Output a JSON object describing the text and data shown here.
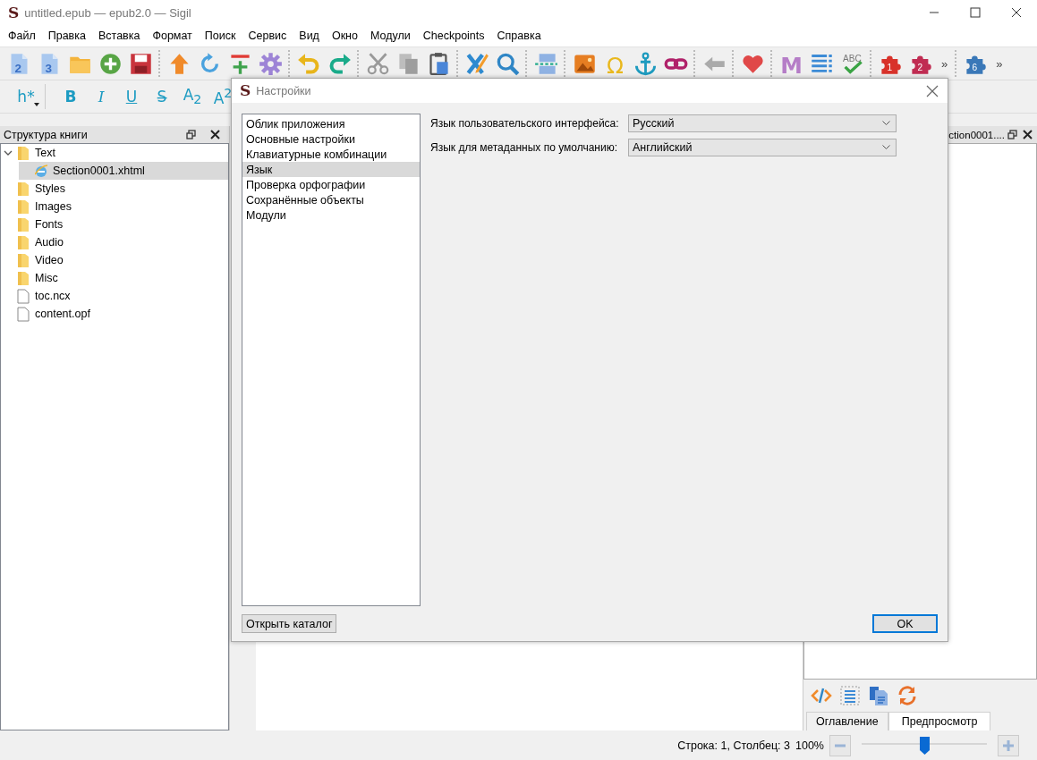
{
  "window": {
    "logo": "S",
    "title": "untitled.epub — epub2.0 — Sigil"
  },
  "menu": [
    "Файл",
    "Правка",
    "Вставка",
    "Формат",
    "Поиск",
    "Сервис",
    "Вид",
    "Окно",
    "Модули",
    "Checkpoints",
    "Справка"
  ],
  "main_toolbar": {
    "icon_texts": [
      "2",
      "3",
      "Ω",
      "M",
      "ABC",
      "1",
      "2",
      "6"
    ],
    "overflow": [
      "»",
      "»"
    ]
  },
  "format_toolbar": [
    "h*",
    "B",
    "I",
    "U",
    "S̶",
    "A$_{2}$",
    "A$^{2}$"
  ],
  "book_browser": {
    "title": "Структура книги",
    "tree": [
      {
        "label": "Text",
        "kind": "folder",
        "expanded": true,
        "selected": false,
        "children": [
          {
            "label": "Section0001.xhtml",
            "kind": "page",
            "selected": true
          }
        ]
      },
      {
        "label": "Styles",
        "kind": "folder",
        "selected": false
      },
      {
        "label": "Images",
        "kind": "folder",
        "selected": false
      },
      {
        "label": "Fonts",
        "kind": "folder",
        "selected": false
      },
      {
        "label": "Audio",
        "kind": "folder",
        "selected": false
      },
      {
        "label": "Video",
        "kind": "folder",
        "selected": false
      },
      {
        "label": "Misc",
        "kind": "folder",
        "selected": false
      },
      {
        "label": "toc.ncx",
        "kind": "file",
        "selected": false
      },
      {
        "label": "content.opf",
        "kind": "file",
        "selected": false
      }
    ]
  },
  "preview_panel": {
    "title": "ction0001....",
    "tabs": [
      {
        "label": "Оглавление",
        "selected": false
      },
      {
        "label": "Предпросмотр",
        "selected": true
      }
    ]
  },
  "dialog": {
    "logo": "S",
    "title": "Настройки",
    "categories": [
      {
        "label": "Облик приложения",
        "selected": false
      },
      {
        "label": "Основные настройки",
        "selected": false
      },
      {
        "label": "Клавиатурные комбинации",
        "selected": false
      },
      {
        "label": "Язык",
        "selected": true
      },
      {
        "label": "Проверка орфографии",
        "selected": false
      },
      {
        "label": "Сохранённые объекты",
        "selected": false
      },
      {
        "label": "Модули",
        "selected": false
      }
    ],
    "fields": [
      {
        "label": "Язык пользовательского интерфейса:",
        "value": "Русский"
      },
      {
        "label": "Язык для метаданных по умолчанию:",
        "value": "Английский"
      }
    ],
    "buttons": [
      {
        "label": "Открыть каталог",
        "kind": "secondary"
      },
      {
        "label": "OK",
        "kind": "default"
      }
    ]
  },
  "status_bar": {
    "position": "Строка: 1, Столбец: 3",
    "zoom": "100%",
    "zoom_slider": {
      "level": 0.5
    }
  }
}
